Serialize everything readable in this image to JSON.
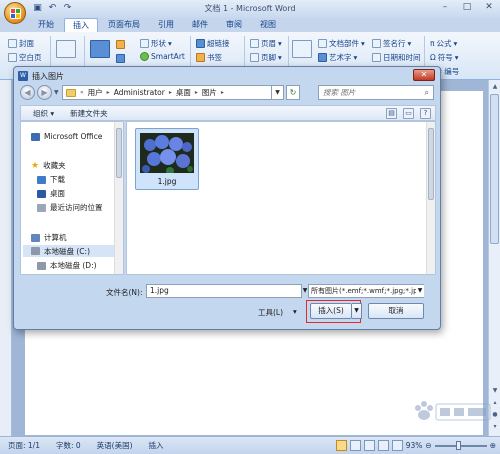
{
  "app": {
    "title": "文档 1 - Microsoft Word",
    "qat": [
      "save-icon",
      "undo-icon",
      "redo-icon"
    ],
    "window_controls": [
      "minimize",
      "maximize",
      "close"
    ]
  },
  "ribbon": {
    "tabs": [
      "开始",
      "插入",
      "页面布局",
      "引用",
      "邮件",
      "审阅",
      "视图"
    ],
    "active_tab": "插入",
    "items": {
      "cover": "封面",
      "blank": "空白页",
      "table": "表格",
      "shapes": "形状",
      "smartart": "SmartArt",
      "hyperlink": "超链接",
      "bookmark": "书签",
      "header": "页眉",
      "footer": "页脚",
      "doc_parts": "文档部件",
      "wordart": "艺术字",
      "signature": "签名行",
      "datetime": "日期和时间",
      "formula": "公式",
      "symbol": "符号",
      "number": "编号"
    }
  },
  "dialog": {
    "title": "插入图片",
    "close": "✕",
    "address": {
      "crumbs": [
        "用户",
        "Administrator",
        "桌面",
        "图片"
      ]
    },
    "search_placeholder": "搜索 图片",
    "toolbar": {
      "organize": "组织 ▾",
      "new_folder": "新建文件夹"
    },
    "nav": {
      "microsoft_office": "Microsoft Office",
      "favorites": "收藏夹",
      "downloads": "下载",
      "desktop": "桌面",
      "recent": "最近访问的位置",
      "computer": "计算机",
      "disk_c": "本地磁盘 (C:)",
      "disk_d": "本地磁盘 (D:)"
    },
    "file": {
      "name": "1.jpg"
    },
    "filename_label": "文件名(N):",
    "filename_value": "1.jpg",
    "filetype_value": "所有图片(*.emf;*.wmf;*.jpg;*.jp",
    "tools": "工具(L)",
    "insert": "插入(S)",
    "cancel": "取消"
  },
  "status": {
    "page": "页面: 1/1",
    "words": "字数: 0",
    "language": "英语(美国)",
    "mode": "插入",
    "zoom": "93%",
    "zoom_level": 0.93
  },
  "watermark": "Baidu 经验"
}
